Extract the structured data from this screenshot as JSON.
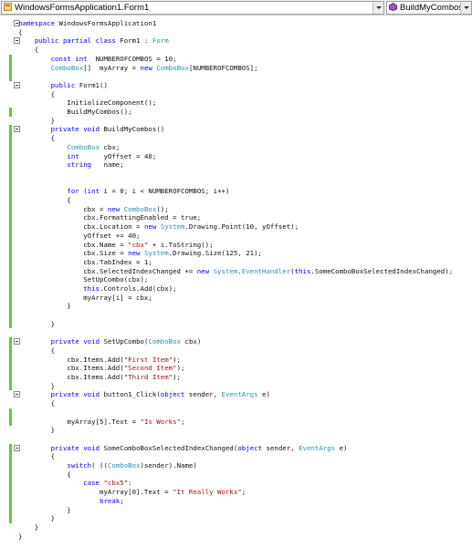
{
  "navbar": {
    "class_combo": "WindowsFormsApplication1.Form1",
    "member_combo": "BuildMyCombos()"
  },
  "code": {
    "lines": [
      {
        "text": "namespace WindowsFormsApplication1",
        "fold": true,
        "chg": false
      },
      {
        "text": "{",
        "fold": false,
        "chg": false
      },
      {
        "text": "    public partial class Form1 : Form",
        "fold": true,
        "chg": false
      },
      {
        "text": "    {",
        "fold": false,
        "chg": false
      },
      {
        "text": "        const int  NUMBEROFCOMBOS = 10;",
        "fold": false,
        "chg": true
      },
      {
        "text": "        ComboBox[]  myArray = new ComboBox[NUMBEROFCOMBOS];",
        "fold": false,
        "chg": true
      },
      {
        "text": "",
        "fold": false,
        "chg": true
      },
      {
        "text": "        public Form1()",
        "fold": true,
        "chg": false
      },
      {
        "text": "        {",
        "fold": false,
        "chg": false
      },
      {
        "text": "            InitializeComponent();",
        "fold": false,
        "chg": false
      },
      {
        "text": "            BuildMyCombos();",
        "fold": false,
        "chg": true
      },
      {
        "text": "        }",
        "fold": false,
        "chg": false
      },
      {
        "text": "        private void BuildMyCombos()",
        "fold": true,
        "chg": true
      },
      {
        "text": "        {",
        "fold": false,
        "chg": true
      },
      {
        "text": "            ComboBox cbx;",
        "fold": false,
        "chg": true
      },
      {
        "text": "            int      yOffset = 40;",
        "fold": false,
        "chg": true
      },
      {
        "text": "            string   name;",
        "fold": false,
        "chg": true
      },
      {
        "text": "",
        "fold": false,
        "chg": true
      },
      {
        "text": "",
        "fold": false,
        "chg": true
      },
      {
        "text": "            for (int i = 0; i < NUMBEROFCOMBOS; i++)",
        "fold": false,
        "chg": true
      },
      {
        "text": "            {",
        "fold": false,
        "chg": true
      },
      {
        "text": "                cbx = new ComboBox();",
        "fold": false,
        "chg": true
      },
      {
        "text": "                cbx.FormattingEnabled = true;",
        "fold": false,
        "chg": true
      },
      {
        "text": "                cbx.Location = new System.Drawing.Point(10, yOffset);",
        "fold": false,
        "chg": true
      },
      {
        "text": "                yOffset += 40;",
        "fold": false,
        "chg": true
      },
      {
        "text": "                cbx.Name = \"cbx\" + i.ToString();",
        "fold": false,
        "chg": true
      },
      {
        "text": "                cbx.Size = new System.Drawing.Size(125, 21);",
        "fold": false,
        "chg": true
      },
      {
        "text": "                cbx.TabIndex = 1;",
        "fold": false,
        "chg": true
      },
      {
        "text": "                cbx.SelectedIndexChanged += new System.EventHandler(this.SomeComboBoxSelectedIndexChanged);",
        "fold": false,
        "chg": true
      },
      {
        "text": "                SetUpCombo(cbx);",
        "fold": false,
        "chg": true
      },
      {
        "text": "                this.Controls.Add(cbx);",
        "fold": false,
        "chg": true
      },
      {
        "text": "                myArray[i] = cbx;",
        "fold": false,
        "chg": true
      },
      {
        "text": "            }",
        "fold": false,
        "chg": true
      },
      {
        "text": "",
        "fold": false,
        "chg": true
      },
      {
        "text": "        }",
        "fold": false,
        "chg": true
      },
      {
        "text": "",
        "fold": false,
        "chg": false
      },
      {
        "text": "        private void SetUpCombo(ComboBox cbx)",
        "fold": true,
        "chg": true
      },
      {
        "text": "        {",
        "fold": false,
        "chg": true
      },
      {
        "text": "            cbx.Items.Add(\"First Item\");",
        "fold": false,
        "chg": true
      },
      {
        "text": "            cbx.Items.Add(\"Second Item\");",
        "fold": false,
        "chg": true
      },
      {
        "text": "            cbx.Items.Add(\"Third Item\");",
        "fold": false,
        "chg": true
      },
      {
        "text": "        }",
        "fold": false,
        "chg": true
      },
      {
        "text": "        private void button1_Click(object sender, EventArgs e)",
        "fold": true,
        "chg": false
      },
      {
        "text": "        {",
        "fold": false,
        "chg": false
      },
      {
        "text": "",
        "fold": false,
        "chg": true
      },
      {
        "text": "            myArray[5].Text = \"Is Works\";",
        "fold": false,
        "chg": true
      },
      {
        "text": "        }",
        "fold": false,
        "chg": false
      },
      {
        "text": "",
        "fold": false,
        "chg": false
      },
      {
        "text": "        private void SomeComboBoxSelectedIndexChanged(object sender, EventArgs e)",
        "fold": true,
        "chg": true
      },
      {
        "text": "        {",
        "fold": false,
        "chg": true
      },
      {
        "text": "            switch( ((ComboBox)sender).Name)",
        "fold": false,
        "chg": true
      },
      {
        "text": "            {",
        "fold": false,
        "chg": true
      },
      {
        "text": "                case \"cbx5\":",
        "fold": false,
        "chg": true
      },
      {
        "text": "                    myArray[0].Text = \"It Really Works\";",
        "fold": false,
        "chg": true
      },
      {
        "text": "                    break;",
        "fold": false,
        "chg": true
      },
      {
        "text": "            }",
        "fold": false,
        "chg": true
      },
      {
        "text": "        }",
        "fold": false,
        "chg": true
      },
      {
        "text": "    }",
        "fold": false,
        "chg": false
      },
      {
        "text": "}",
        "fold": false,
        "chg": false
      }
    ]
  },
  "colors": {
    "keyword": "#0000ff",
    "type": "#2b91af",
    "string": "#a31515",
    "text": "#000000",
    "change_bar": "#6cc24a",
    "margin_bg": "#ffffff"
  }
}
